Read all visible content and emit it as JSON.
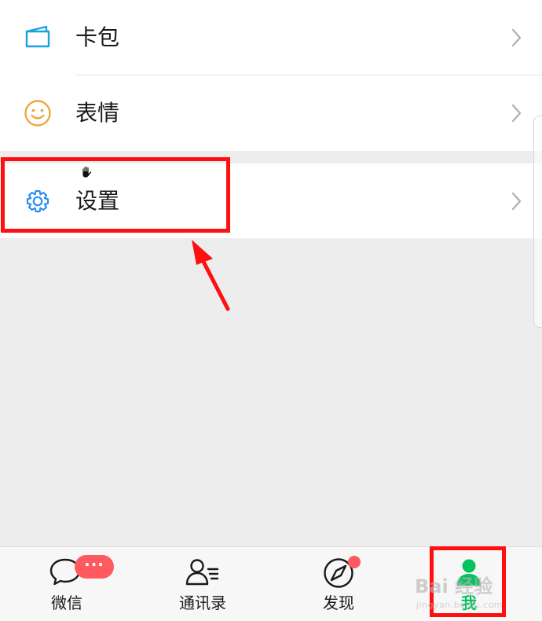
{
  "menu": {
    "items": [
      {
        "label": "卡包",
        "icon": "card-wallet-icon"
      },
      {
        "label": "表情",
        "icon": "smiley-icon"
      },
      {
        "label": "设置",
        "icon": "gear-icon"
      }
    ]
  },
  "bottom_nav": {
    "tabs": [
      {
        "label": "微信",
        "icon": "chat-bubble-icon",
        "badge": "···"
      },
      {
        "label": "通讯录",
        "icon": "contacts-icon"
      },
      {
        "label": "发现",
        "icon": "compass-icon",
        "dot": true
      },
      {
        "label": "我",
        "icon": "person-icon",
        "active": true
      }
    ]
  },
  "watermark": {
    "main": "Bai 经验",
    "sub": "jingyan.baidu.com"
  },
  "colors": {
    "accent": "#07c160",
    "badge": "#ff5a5f",
    "highlight": "#ff1010",
    "settings_icon": "#2d8cf0",
    "cards_icon": "#1aa1de",
    "smiley_icon": "#f0a542"
  }
}
